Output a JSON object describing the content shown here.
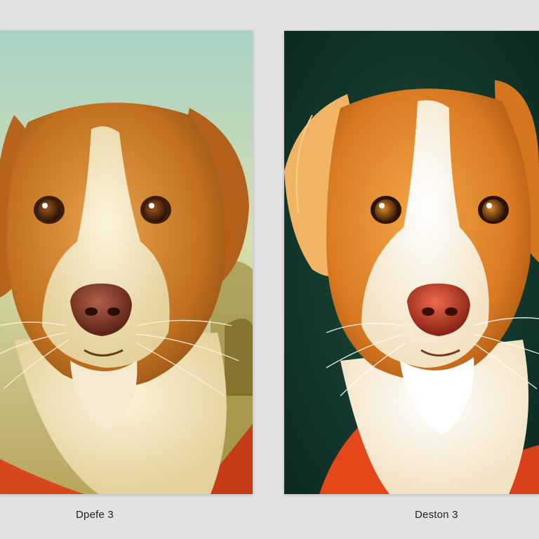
{
  "captions": {
    "left": "Dpefe 3",
    "right": "Deston 3"
  },
  "colors": {
    "page_background": "#e2e2e4",
    "left_sky": "#a9d3c6",
    "right_background": "#14382e",
    "fur_orange": "#d2822c",
    "fur_cream": "#f2e7c4",
    "collar_red": "#d8481c"
  }
}
